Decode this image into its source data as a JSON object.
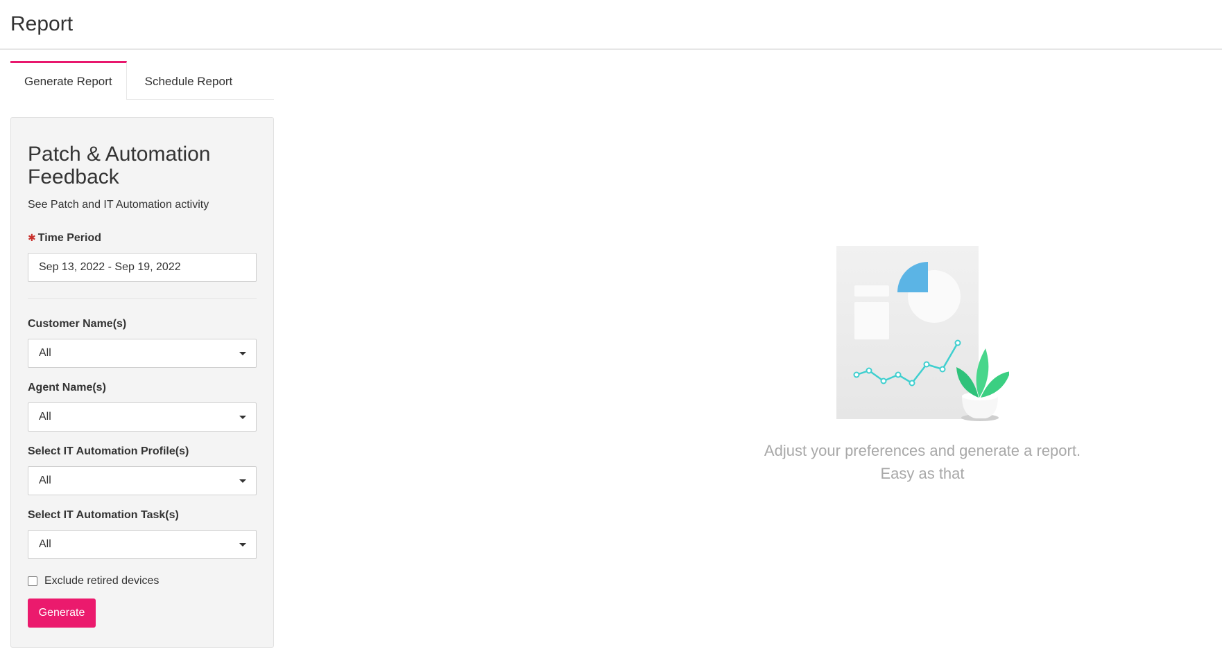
{
  "header": {
    "title": "Report"
  },
  "tabs": [
    {
      "label": "Generate Report",
      "active": true
    },
    {
      "label": "Schedule Report",
      "active": false
    }
  ],
  "panel": {
    "title": "Patch & Automation Feedback",
    "subtitle": "See Patch and IT Automation activity",
    "time_period": {
      "label": "Time Period",
      "required_mark": "✱",
      "value": "Sep 13, 2022 - Sep 19, 2022"
    },
    "customer": {
      "label": "Customer Name(s)",
      "value": "All"
    },
    "agent": {
      "label": "Agent Name(s)",
      "value": "All"
    },
    "profile": {
      "label": "Select IT Automation Profile(s)",
      "value": "All"
    },
    "task": {
      "label": "Select IT Automation Task(s)",
      "value": "All"
    },
    "exclude_retired": {
      "label": "Exclude retired devices",
      "checked": false
    },
    "generate_label": "Generate"
  },
  "empty_state": {
    "line1": "Adjust your preferences and generate a report.",
    "line2": "Easy as that",
    "icon": "report-illustration"
  },
  "colors": {
    "accent": "#eb1a6d",
    "illustration_blue": "#5bb4e5",
    "illustration_teal": "#3fcfcf",
    "plant_green": "#3ecf7a"
  }
}
